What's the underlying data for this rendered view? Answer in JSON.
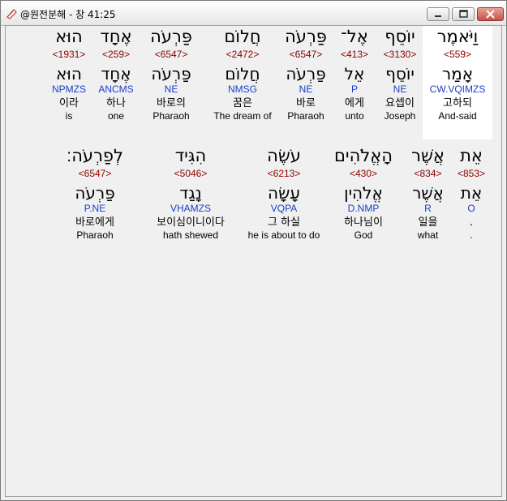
{
  "window": {
    "title": "@원전분해 - 창 41:25"
  },
  "rows": [
    [
      {
        "id": "w1",
        "hebrew": "וַיֹּאמֶר",
        "strong": "<559>",
        "root": "אָמַר",
        "morph": "CW.VQIMZS",
        "korean": "고하되",
        "english": "And-said",
        "selected": true
      },
      {
        "id": "w2",
        "hebrew": "יוֹסֵף",
        "strong": "<3130>",
        "root": "יוֹסֵף",
        "morph": "NE",
        "korean": "요셉이",
        "english": "Joseph",
        "selected": false
      },
      {
        "id": "w3",
        "hebrew": "אֶל־",
        "strong": "<413>",
        "root": "אֵל",
        "morph": "P",
        "korean": "에게",
        "english": "unto",
        "selected": false
      },
      {
        "id": "w4",
        "hebrew": "פַּרְעֹה",
        "strong": "<6547>",
        "root": "פַּרְעֹה",
        "morph": "NE",
        "korean": "바로",
        "english": "Pharaoh",
        "selected": false
      },
      {
        "id": "w5",
        "hebrew": "חֲלוֹם",
        "strong": "<2472>",
        "root": "חֲלוֹם",
        "morph": "NMSG",
        "korean": "꿈은",
        "english": "The dream of",
        "selected": false
      },
      {
        "id": "w6",
        "hebrew": "פַּרְעֹה",
        "strong": "<6547>",
        "root": "פַּרְעֹה",
        "morph": "NE",
        "korean": "바로의",
        "english": "Pharaoh",
        "selected": false
      },
      {
        "id": "w7",
        "hebrew": "אֶחָד",
        "strong": "<259>",
        "root": "אֶחָד",
        "morph": "ANCMS",
        "korean": "하나",
        "english": "one",
        "selected": false
      },
      {
        "id": "w8",
        "hebrew": "הוּא",
        "strong": "<1931>",
        "root": "הוּא",
        "morph": "NPMZS",
        "korean": "이라",
        "english": "is",
        "selected": false
      }
    ],
    [
      {
        "id": "w9",
        "hebrew": "אֵת",
        "strong": "<853>",
        "root": "אֵת",
        "morph": "O",
        "korean": ".",
        "english": ".",
        "selected": false
      },
      {
        "id": "w10",
        "hebrew": "אֲשֶׁר",
        "strong": "<834>",
        "root": "אֲשֶׁר",
        "morph": "R",
        "korean": "일을",
        "english": "what",
        "selected": false
      },
      {
        "id": "w11",
        "hebrew": "הָאֱלֹהִים",
        "strong": "<430>",
        "root": "אֱלֹהִין",
        "morph": "D.NMP",
        "korean": "하나님이",
        "english": "God",
        "selected": false
      },
      {
        "id": "w12",
        "hebrew": "עֹשֶׂה",
        "strong": "<6213>",
        "root": "עָשָׂה",
        "morph": "VQPA",
        "korean": "그 하실",
        "english": "he is about to do",
        "selected": false
      },
      {
        "id": "w13",
        "hebrew": "הִגִּיד",
        "strong": "<5046>",
        "root": "נָגַד",
        "morph": "VHAMZS",
        "korean": "보이심이니이다",
        "english": "hath shewed",
        "selected": false
      },
      {
        "id": "w14",
        "hebrew": "לְפַרְעֹה׃",
        "strong": "<6547>",
        "root": "פַּרְעֹה",
        "morph": "P.NE",
        "korean": "바로에게",
        "english": "Pharaoh",
        "selected": false
      }
    ]
  ]
}
